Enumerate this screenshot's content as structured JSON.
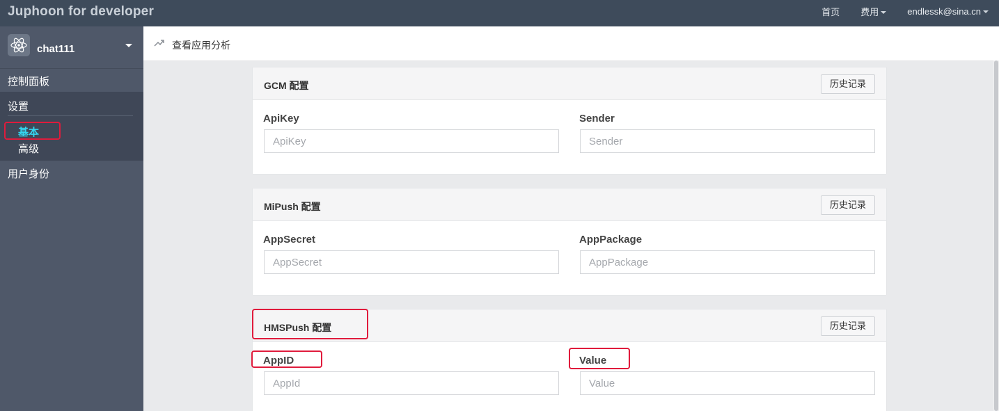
{
  "brand": "Juphoon for developer",
  "topnav": {
    "home": "首页",
    "pricing": "费用",
    "account": "endlessk@sina.cn"
  },
  "sidebar": {
    "app_name": "chat111",
    "dashboard": "控制面板",
    "settings": "设置",
    "basic": "基本",
    "advanced": "高级",
    "user_identity": "用户身份"
  },
  "subheader": {
    "title": "查看应用分析"
  },
  "panels": [
    {
      "title": "GCM 配置",
      "history": "历史记录",
      "fields": [
        {
          "label": "ApiKey",
          "placeholder": "ApiKey"
        },
        {
          "label": "Sender",
          "placeholder": "Sender"
        }
      ]
    },
    {
      "title": "MiPush 配置",
      "history": "历史记录",
      "fields": [
        {
          "label": "AppSecret",
          "placeholder": "AppSecret"
        },
        {
          "label": "AppPackage",
          "placeholder": "AppPackage"
        }
      ]
    },
    {
      "title": "HMSPush 配置",
      "history": "历史记录",
      "fields": [
        {
          "label": "AppID",
          "placeholder": "AppId"
        },
        {
          "label": "Value",
          "placeholder": "Value"
        }
      ]
    }
  ],
  "colors": {
    "topbar": "#3e4b5b",
    "sidebar": "#4f5869",
    "active": "#33d6f0",
    "highlight": "#e01b3c"
  }
}
